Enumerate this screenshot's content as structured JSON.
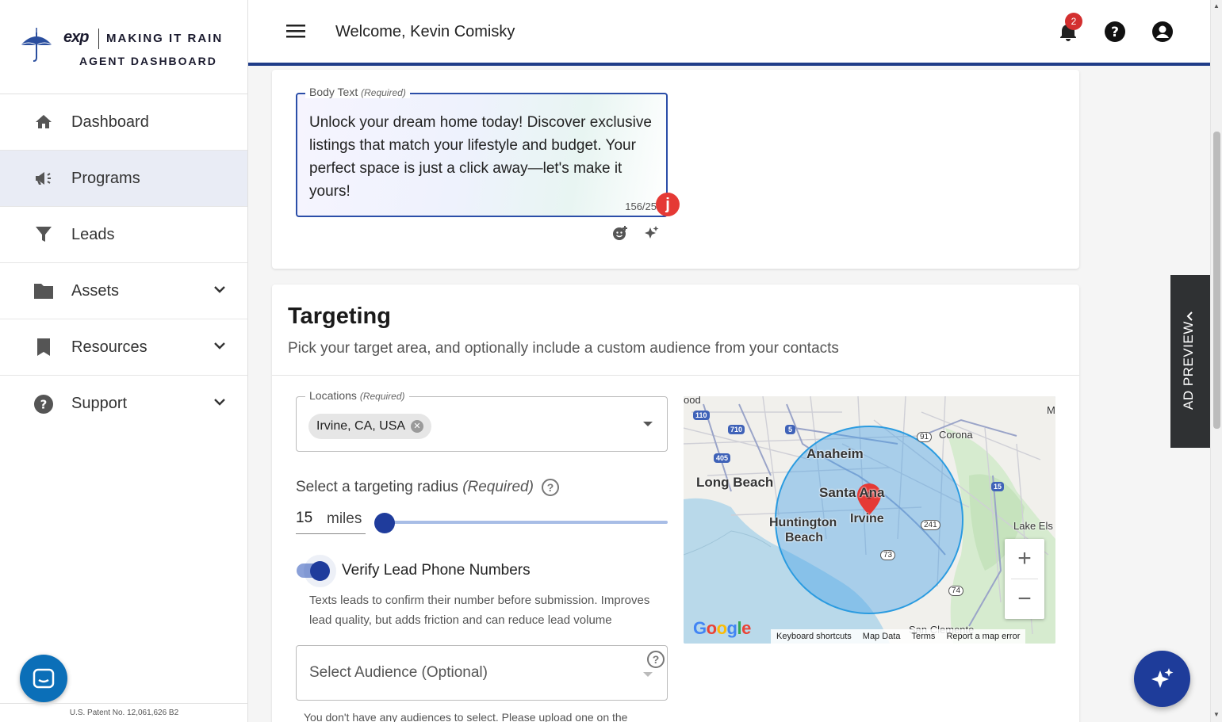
{
  "logo": {
    "brand": "exp",
    "line1": "MAKING IT RAIN",
    "line2": "AGENT DASHBOARD"
  },
  "sidebar": {
    "items": [
      {
        "label": "Dashboard",
        "icon": "home-icon"
      },
      {
        "label": "Programs",
        "icon": "megaphone-icon",
        "active": true
      },
      {
        "label": "Leads",
        "icon": "funnel-icon"
      },
      {
        "label": "Assets",
        "icon": "folder-icon",
        "expandable": true
      },
      {
        "label": "Resources",
        "icon": "bookmark-icon",
        "expandable": true
      },
      {
        "label": "Support",
        "icon": "help-circle-icon",
        "expandable": true
      }
    ],
    "patent": "U.S. Patent No. 12,061,626 B2"
  },
  "topbar": {
    "welcome": "Welcome, Kevin Comisky",
    "notification_count": "2"
  },
  "body_text": {
    "label": "Body Text",
    "required": "(Required)",
    "value": "Unlock your dream home today! Discover exclusive listings that match your lifestyle and budget. Your perfect space is just a click away—let's make it yours!",
    "counter": "156/25",
    "warning_glyph": "j"
  },
  "targeting": {
    "title": "Targeting",
    "subtitle": "Pick your target area, and optionally include a custom audience from your contacts",
    "locations_label": "Locations",
    "locations_required": "(Required)",
    "location_chip": "Irvine, CA, USA",
    "radius_label": "Select a targeting radius",
    "radius_required": "(Required)",
    "radius_value": "15",
    "radius_unit": "miles",
    "radius_slider_fraction": 0.0,
    "verify_label": "Verify Lead Phone Numbers",
    "verify_on": true,
    "verify_desc": "Texts leads to confirm their number before submission. Improves lead quality, but adds friction and can reduce lead volume",
    "audience_placeholder": "Select Audience (Optional)",
    "audience_note": "You don't have any audiences to select. Please upload one on the"
  },
  "map": {
    "cities": [
      "Anaheim",
      "Long Beach",
      "Santa Ana",
      "Irvine",
      "Huntington",
      "Beach",
      "Corona",
      "Lake Els",
      "San Clemente",
      "ood",
      "M"
    ],
    "routes": [
      "110",
      "710",
      "5",
      "405",
      "91",
      "15",
      "241",
      "73",
      "74"
    ],
    "google": "Google",
    "footer": [
      "Keyboard shortcuts",
      "Map Data",
      "Terms",
      "Report a map error"
    ],
    "zoom_in": "+",
    "zoom_out": "−"
  },
  "ad_preview": {
    "label": "AD PREVIEW"
  },
  "colors": {
    "primary": "#1f3c88",
    "accent_blue": "#1e3c9a",
    "chat_blue": "#0b6fb8",
    "danger": "#d32f2f"
  }
}
